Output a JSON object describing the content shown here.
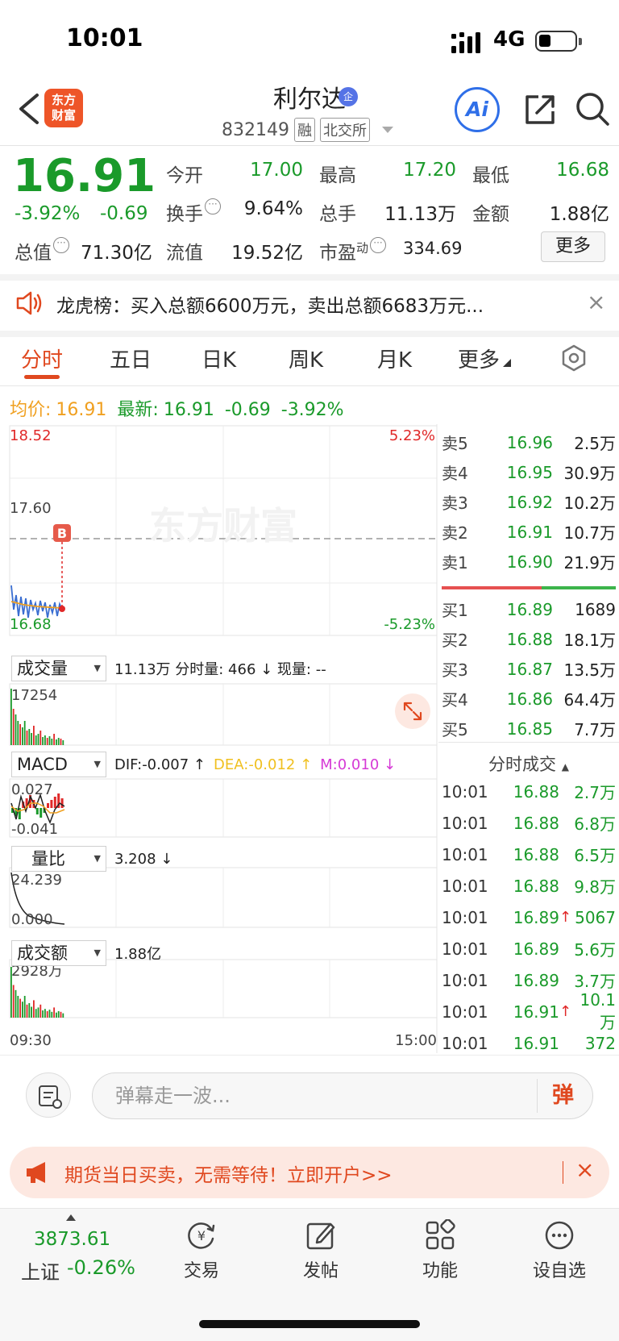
{
  "status": {
    "time": "10:01",
    "network": "4G"
  },
  "header": {
    "logo": [
      "东方",
      "财富"
    ],
    "name": "利尔达",
    "badge": "企",
    "code": "832149",
    "tag_margin": "融",
    "tag_exchange": "北交所",
    "ai": "Ai"
  },
  "quote": {
    "price": "16.91",
    "change_pct": "-3.92%",
    "change_abs": "-0.69",
    "rows": [
      [
        {
          "label": "今开",
          "value": "17.00",
          "color": "green"
        },
        {
          "label": "最高",
          "value": "17.20",
          "color": "green"
        },
        {
          "label": "最低",
          "value": "16.68",
          "color": "green"
        }
      ],
      [
        {
          "label": "换手",
          "value": "9.64%",
          "color": "black",
          "dots": true
        },
        {
          "label": "总手",
          "value": "11.13万",
          "color": "black"
        },
        {
          "label": "金额",
          "value": "1.88亿",
          "color": "black"
        }
      ]
    ],
    "total_value_label": "总值",
    "total_value": "71.30亿",
    "float_value_label": "流值",
    "float_value": "19.52亿",
    "pe_label": "市盈",
    "pe_sup": "动",
    "pe_value": "334.69",
    "more_label": "更多"
  },
  "notice": {
    "text": "龙虎榜：买入总额6600万元，卖出总额6683万元..."
  },
  "tabs": [
    "分时",
    "五日",
    "日K",
    "周K",
    "月K",
    "更多"
  ],
  "avg_line": {
    "avg_label": "均价:",
    "avg_value": "16.91",
    "latest_label": "最新:",
    "latest_value": "16.91",
    "change_abs": "-0.69",
    "change_pct": "-3.92%"
  },
  "chart": {
    "price_top": "18.52",
    "price_mid": "17.60",
    "price_bottom": "16.68",
    "pct_top": "5.23%",
    "pct_bottom": "-5.23%",
    "buy_marker": "B",
    "watermark": "东方财富",
    "volume": {
      "selector": "成交量",
      "text": "11.13万 分时量: 466 ↓ 现量: --",
      "max": "17254"
    },
    "macd": {
      "selector": "MACD",
      "dif": "DIF:-0.007 ↑",
      "dea": "DEA:-0.012 ↑",
      "m": "M:0.010 ↓",
      "top": "0.027",
      "bottom": "-0.041"
    },
    "ratio": {
      "selector": "量比",
      "text": "3.208 ↓",
      "top": "24.239",
      "bottom": "0.000"
    },
    "amount": {
      "selector": "成交额",
      "text": "1.88亿",
      "max": "2928万"
    },
    "time_start": "09:30",
    "time_end": "15:00"
  },
  "orderbook": {
    "asks": [
      {
        "label": "卖5",
        "price": "16.96",
        "vol": "2.5万"
      },
      {
        "label": "卖4",
        "price": "16.95",
        "vol": "30.9万"
      },
      {
        "label": "卖3",
        "price": "16.92",
        "vol": "10.2万"
      },
      {
        "label": "卖2",
        "price": "16.91",
        "vol": "10.7万"
      },
      {
        "label": "卖1",
        "price": "16.90",
        "vol": "21.9万"
      }
    ],
    "bids": [
      {
        "label": "买1",
        "price": "16.89",
        "vol": "1689"
      },
      {
        "label": "买2",
        "price": "16.88",
        "vol": "18.1万"
      },
      {
        "label": "买3",
        "price": "16.87",
        "vol": "13.5万"
      },
      {
        "label": "买4",
        "price": "16.86",
        "vol": "64.4万"
      },
      {
        "label": "买5",
        "price": "16.85",
        "vol": "7.7万"
      }
    ]
  },
  "trades": {
    "title": "分时成交",
    "rows": [
      {
        "time": "10:01",
        "price": "16.88",
        "dir": "",
        "vol": "2.7万"
      },
      {
        "time": "10:01",
        "price": "16.88",
        "dir": "",
        "vol": "6.8万"
      },
      {
        "time": "10:01",
        "price": "16.88",
        "dir": "",
        "vol": "6.5万"
      },
      {
        "time": "10:01",
        "price": "16.88",
        "dir": "",
        "vol": "9.8万"
      },
      {
        "time": "10:01",
        "price": "16.89",
        "dir": "↑",
        "vol": "5067"
      },
      {
        "time": "10:01",
        "price": "16.89",
        "dir": "",
        "vol": "5.6万"
      },
      {
        "time": "10:01",
        "price": "16.89",
        "dir": "",
        "vol": "3.7万"
      },
      {
        "time": "10:01",
        "price": "16.91",
        "dir": "↑",
        "vol": "10.1万"
      },
      {
        "time": "10:01",
        "price": "16.91",
        "dir": "",
        "vol": "372"
      }
    ]
  },
  "comment": {
    "placeholder": "弹幕走一波...",
    "send": "弹"
  },
  "ad": {
    "text": "期货当日买卖，无需等待！立即开户>>"
  },
  "bottom_nav": {
    "index_value": "3873.61",
    "index_name": "上证",
    "index_change": "-0.26%",
    "items": [
      "交易",
      "发帖",
      "功能",
      "设自选"
    ]
  },
  "colors": {
    "up": "#e02828",
    "down": "#1a9a2a",
    "accent": "#e0481f",
    "ai": "#2f6fe8"
  }
}
